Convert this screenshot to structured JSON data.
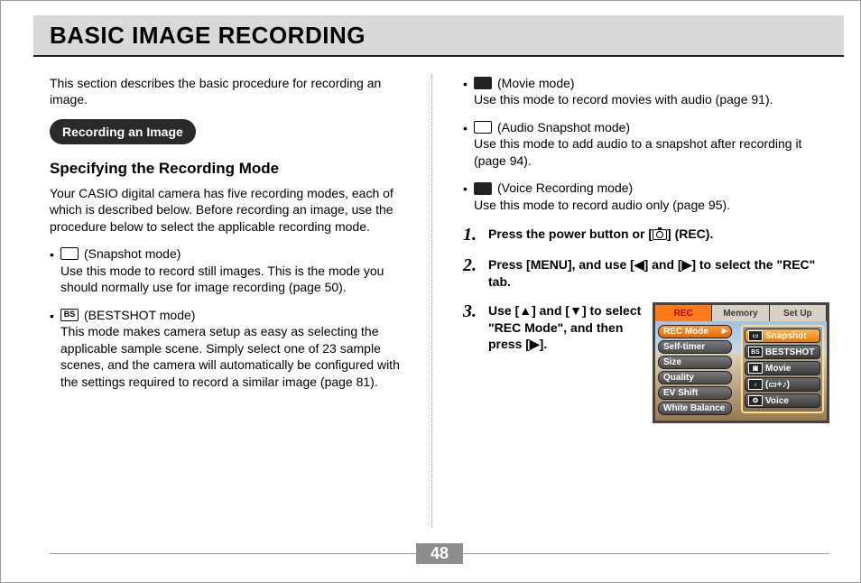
{
  "title": "BASIC IMAGE RECORDING",
  "intro": "This section describes the basic procedure for recording an image.",
  "section_pill": "Recording an Image",
  "subheading": "Specifying the Recording Mode",
  "subpara": "Your CASIO digital camera has five recording modes, each of which is described below. Before recording an image, use the procedure below to select the applicable recording mode.",
  "modes_left": [
    {
      "icon_text": "",
      "icon_name": "snapshot-mode-icon",
      "icon_dark": false,
      "label": "(Snapshot mode)",
      "desc": "Use this mode to record still images. This is the mode you should normally use for image recording (page 50)."
    },
    {
      "icon_text": "BS",
      "icon_name": "bestshot-mode-icon",
      "icon_dark": false,
      "label": "(BESTSHOT mode)",
      "desc": "This mode makes camera setup as easy as selecting the applicable sample scene. Simply select one of 23 sample scenes, and the camera will automatically be configured with the settings required to record a similar image (page 81)."
    }
  ],
  "modes_right": [
    {
      "icon_text": "",
      "icon_name": "movie-mode-icon",
      "icon_dark": true,
      "label": "(Movie mode)",
      "desc": "Use this mode to record movies with audio (page 91)."
    },
    {
      "icon_text": "",
      "icon_name": "audio-snapshot-mode-icon",
      "icon_dark": false,
      "label": "(Audio Snapshot mode)",
      "desc": "Use this mode to add audio to a snapshot after recording it (page 94)."
    },
    {
      "icon_text": "",
      "icon_name": "voice-recording-mode-icon",
      "icon_dark": true,
      "label": "(Voice Recording mode)",
      "desc": "Use this mode to record audio only (page 95)."
    }
  ],
  "steps": [
    {
      "pre": "Press the power button or [",
      "has_cam_icon": true,
      "post": "] (REC)."
    },
    {
      "pre": "Press [MENU], and use [◀] and [▶] to select the \"REC\" tab.",
      "has_cam_icon": false,
      "post": ""
    },
    {
      "pre": "Use [▲] and [▼] to select \"REC Mode\", and then press [▶].",
      "has_cam_icon": false,
      "post": ""
    }
  ],
  "lcd": {
    "tabs": {
      "rec": "REC",
      "memory": "Memory",
      "setup": "Set Up"
    },
    "left_items": [
      "REC Mode",
      "Self-timer",
      "Size",
      "Quality",
      "EV Shift",
      "White Balance"
    ],
    "right_items": [
      {
        "icon": "▭",
        "label": "Snapshot"
      },
      {
        "icon": "BS",
        "label": "BESTSHOT"
      },
      {
        "icon": "▣",
        "label": "Movie"
      },
      {
        "icon": "♪",
        "label": "(▭+♪)"
      },
      {
        "icon": "✪",
        "label": "Voice"
      }
    ]
  },
  "page_number": "48"
}
